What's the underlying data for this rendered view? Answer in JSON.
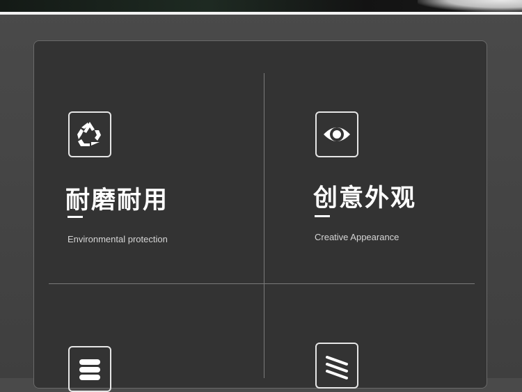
{
  "features": [
    {
      "icon": "recycle-icon",
      "title": "耐磨耐用",
      "subtitle": "Environmental protection"
    },
    {
      "icon": "eye-icon",
      "title": "创意外观",
      "subtitle": "Creative Appearance"
    },
    {
      "icon": "stack-icon",
      "title": "",
      "subtitle": ""
    },
    {
      "icon": "stripes-icon",
      "title": "",
      "subtitle": ""
    }
  ],
  "colors": {
    "panel": "#333333",
    "text": "#ffffff",
    "divider": "#7a7a7a"
  }
}
